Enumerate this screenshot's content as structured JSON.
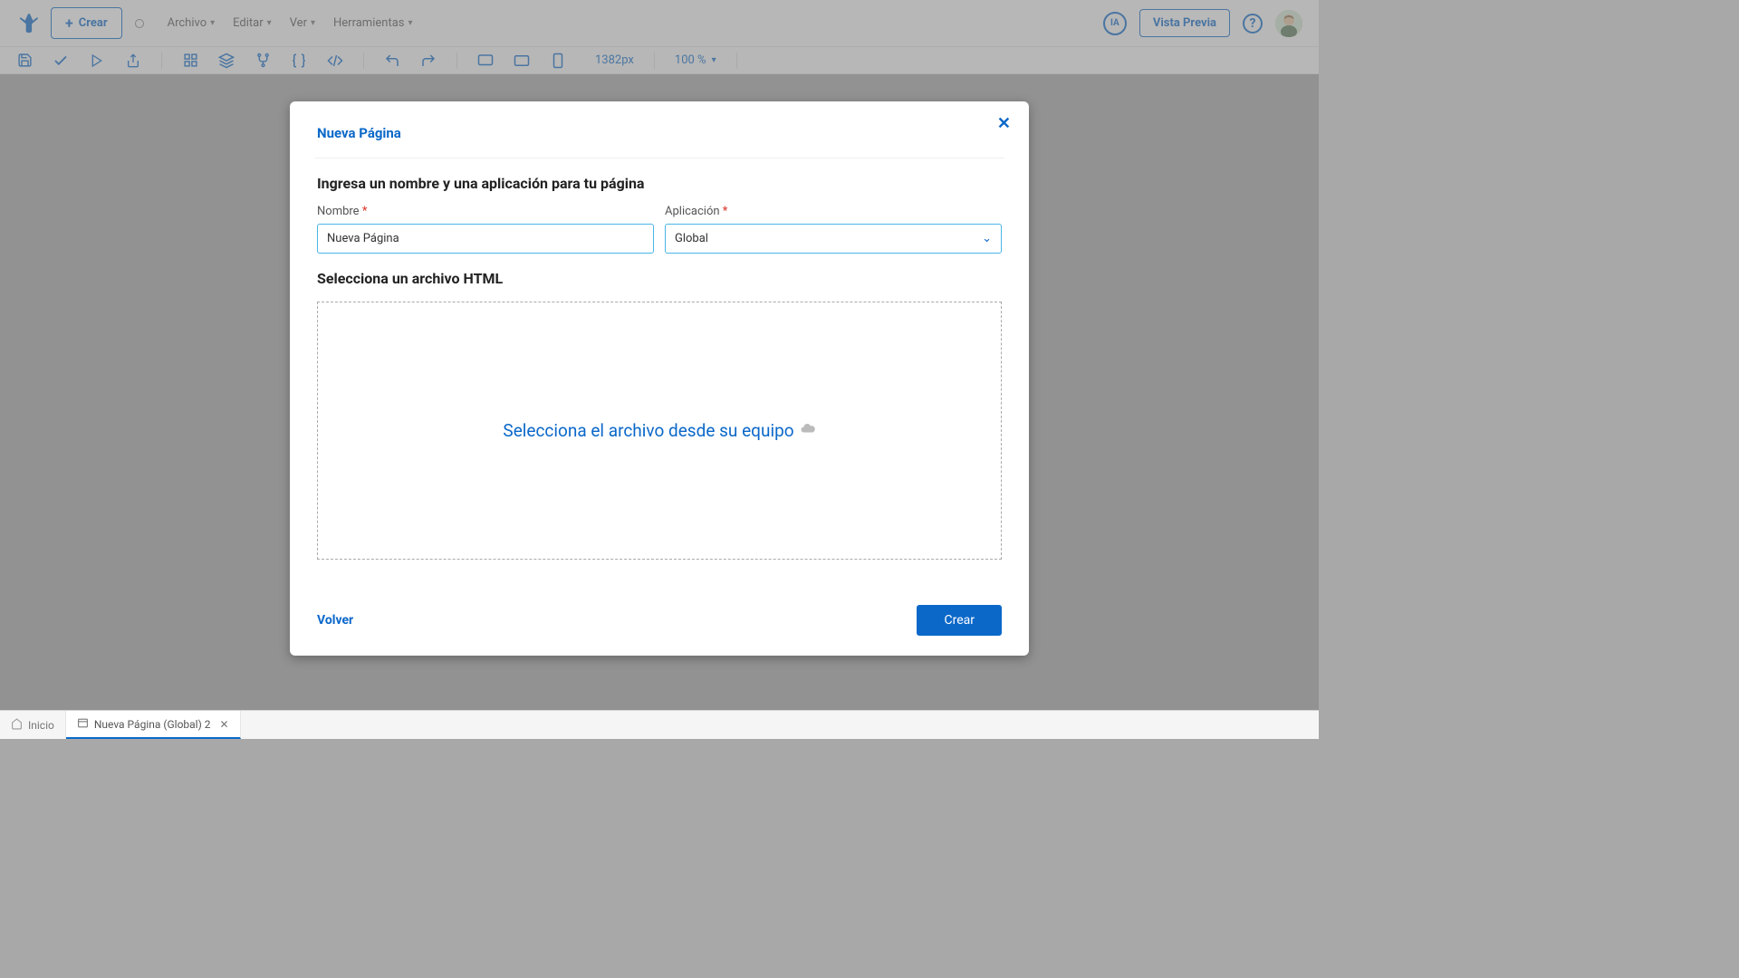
{
  "header": {
    "create_label": "Crear",
    "menu": [
      "Archivo",
      "Editar",
      "Ver",
      "Herramientas"
    ],
    "ia_label": "IA",
    "preview_label": "Vista Previa"
  },
  "toolbar": {
    "width_label": "1382px",
    "zoom_label": "100 %"
  },
  "modal": {
    "title": "Nueva Página",
    "subtitle": "Ingresa un nombre y una aplicación para tu página",
    "name_label": "Nombre",
    "name_value": "Nueva Página",
    "app_label": "Aplicación",
    "app_value": "Global",
    "file_section": "Selecciona un archivo HTML",
    "dropzone_text": "Selecciona el archivo desde su equipo",
    "back_label": "Volver",
    "create_label": "Crear"
  },
  "tabs": {
    "home": "Inicio",
    "active": "Nueva Página (Global) 2"
  }
}
